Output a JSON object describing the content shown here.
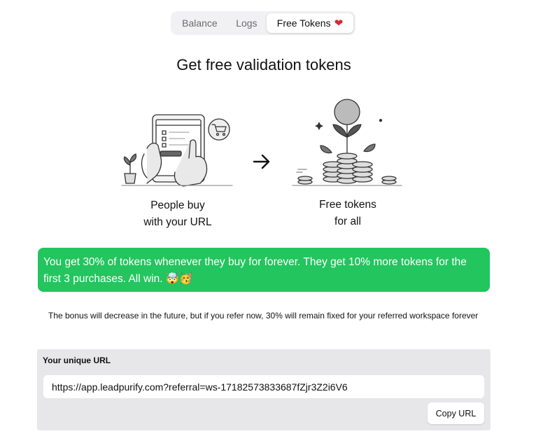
{
  "tabs": [
    {
      "label": "Balance"
    },
    {
      "label": "Logs"
    },
    {
      "label": "Free Tokens",
      "emoji": "❤️",
      "active": true
    }
  ],
  "heading": "Get free validation tokens",
  "steps": [
    {
      "line1": "People buy",
      "line2": "with your URL",
      "icon": "tablet-hand-shopping-illustration"
    },
    {
      "line1": "Free tokens",
      "line2": "for all",
      "icon": "coin-stacks-plant-illustration"
    }
  ],
  "banner": {
    "text": "You get 30% of tokens whenever they buy for forever. They get 10% more tokens for the first 3 purchases. All win. 🤯🥳",
    "color": "#22c55e"
  },
  "note": "The bonus will decrease in the future, but if you refer now, 30% will remain fixed for your referred workspace forever",
  "referral": {
    "label": "Your unique URL",
    "url": "https://app.leadpurify.com?referral=ws-17182573833687fZjr3Z2i6V6",
    "copy_label": "Copy URL"
  }
}
